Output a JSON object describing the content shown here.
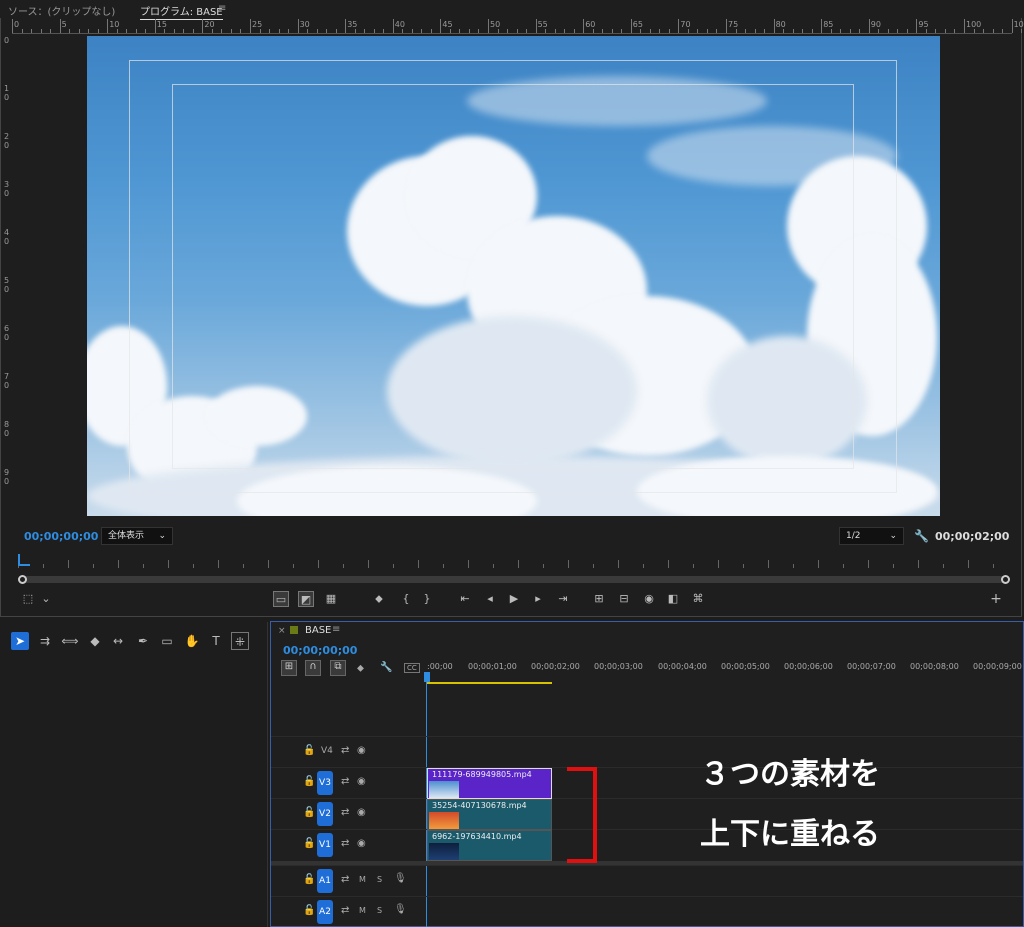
{
  "monitor": {
    "source_tab": "ソース：(クリップなし)",
    "program_tab": "プログラム: BASE",
    "menu_icon": "≡",
    "ruler_labels": [
      "0",
      "5",
      "10",
      "15",
      "20",
      "25",
      "30",
      "35",
      "40",
      "45",
      "50",
      "55",
      "60",
      "65",
      "70",
      "75",
      "80",
      "85",
      "90",
      "95",
      "100",
      "105"
    ],
    "vruler_labels": [
      "0",
      "1 0",
      "2 0",
      "3 0",
      "4 0",
      "5 0",
      "6 0",
      "7 0",
      "8 0",
      "9 0"
    ],
    "current_timecode": "00;00;00;00",
    "zoom_select": "全体表示",
    "resolution_select": "1/2",
    "duration_timecode": "00;00;02;00"
  },
  "timeline": {
    "sequence_name": "BASE",
    "current_timecode": "00;00;00;00",
    "ruler_labels": [
      ":00;00",
      "00;00;01;00",
      "00;00;02;00",
      "00;00;03;00",
      "00;00;04;00",
      "00;00;05;00",
      "00;00;06;00",
      "00;00;07;00",
      "00;00;08;00",
      "00;00;09;00"
    ],
    "tracks": [
      {
        "name": "V4",
        "active": false
      },
      {
        "name": "V3",
        "active": true
      },
      {
        "name": "V2",
        "active": true
      },
      {
        "name": "V1",
        "active": true
      },
      {
        "name": "A1",
        "active": true
      },
      {
        "name": "A2",
        "active": true
      }
    ],
    "clips": [
      {
        "name": "111179-689949805.mp4",
        "track": "V3",
        "color": "#5a24c9"
      },
      {
        "name": "35254-407130678.mp4",
        "track": "V2",
        "color": "#1b5a6a"
      },
      {
        "name": "6962-197634410.mp4",
        "track": "V1",
        "color": "#1b5a6a"
      }
    ],
    "audio_m": "M",
    "audio_s": "S"
  },
  "annotation": {
    "line1": "３つの素材を",
    "line2": "上下に重ねる",
    "color": "#e01010"
  }
}
